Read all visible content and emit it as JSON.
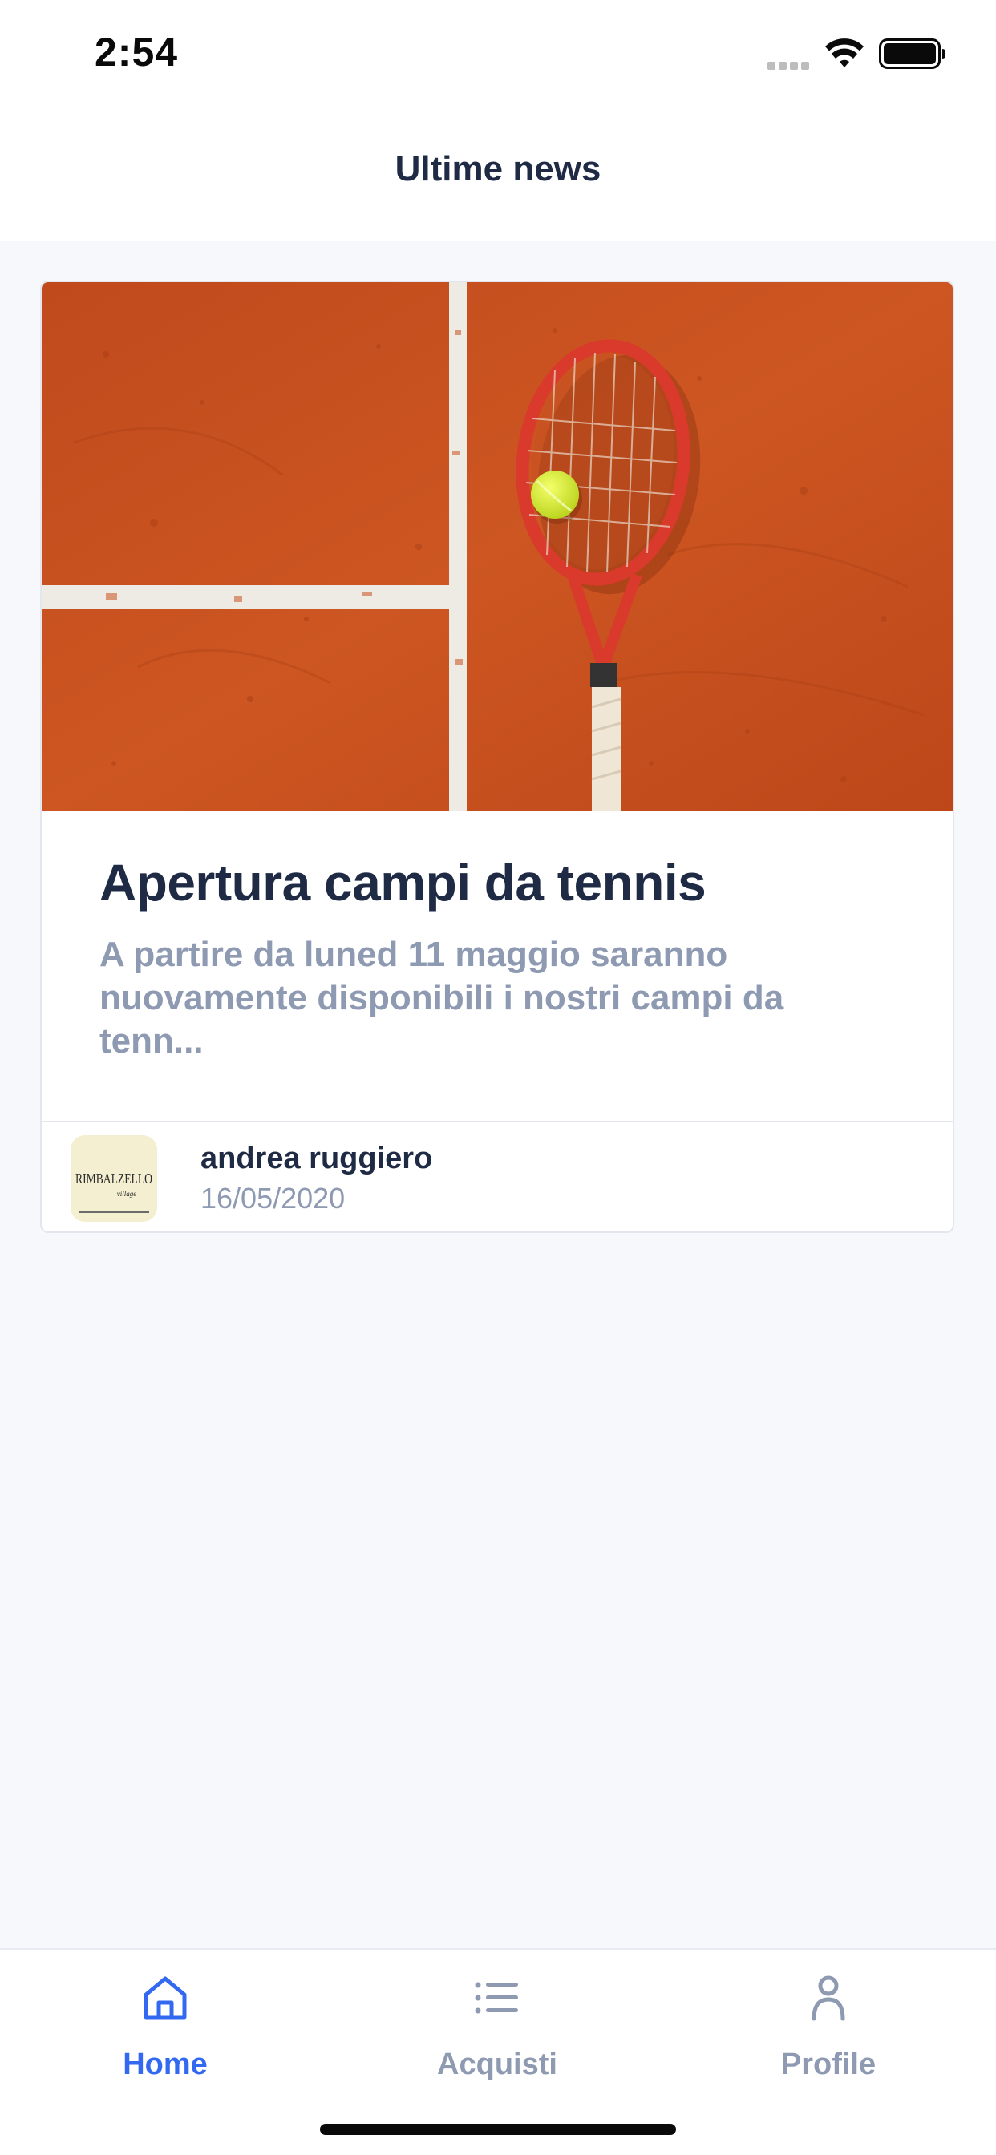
{
  "status_bar": {
    "time": "2:54"
  },
  "header": {
    "title": "Ultime news"
  },
  "news": [
    {
      "title": "Apertura campi da tennis",
      "excerpt": "A partire da luned 11 maggio saranno nuovamente disponibili i nostri campi da tenn...",
      "author": "andrea ruggiero",
      "date": "16/05/2020",
      "avatar_logo_text": "RIMBALZELLO village"
    }
  ],
  "tabs": [
    {
      "label": "Home",
      "icon": "home-icon",
      "active": true
    },
    {
      "label": "Acquisti",
      "icon": "list-icon",
      "active": false
    },
    {
      "label": "Profile",
      "icon": "person-icon",
      "active": false
    }
  ],
  "colors": {
    "accent": "#3368f0",
    "inactive": "#8e9ab2",
    "title": "#1f2a44",
    "background": "#f7f8fc",
    "clay": "#c9521f"
  }
}
